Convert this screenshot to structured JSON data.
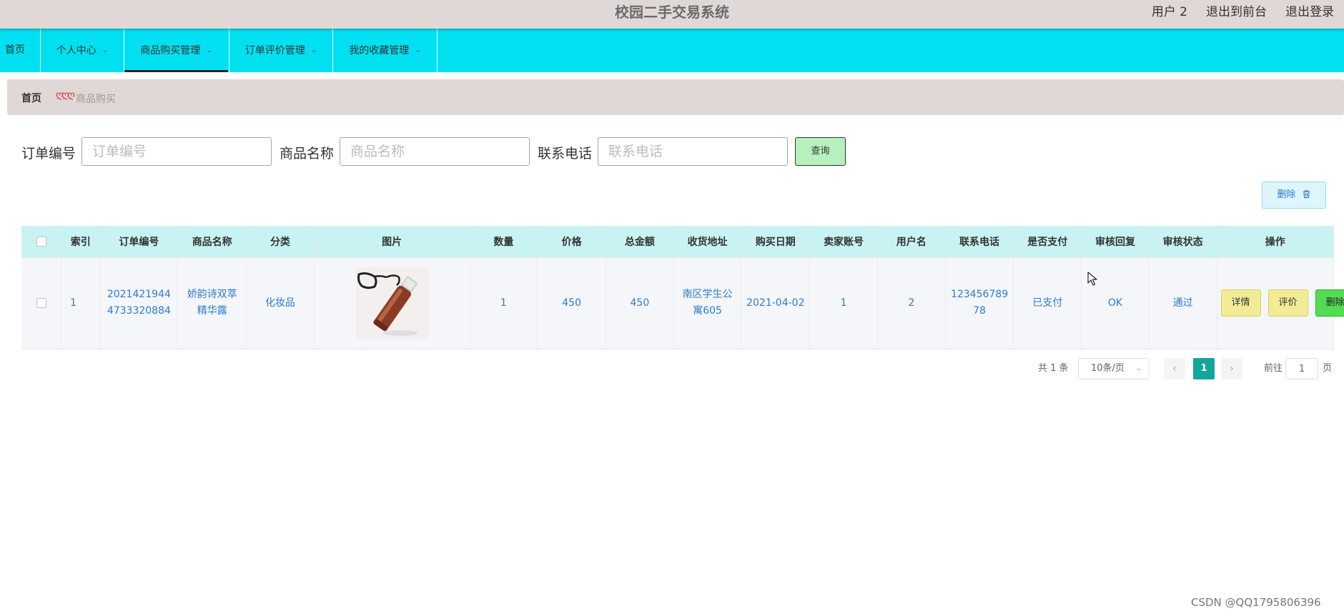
{
  "header": {
    "system_title": "校园二手交易系统",
    "user_label": "用户 2",
    "back_to_front": "退出到前台",
    "logout": "退出登录"
  },
  "nav": {
    "items": [
      {
        "label": "首页",
        "has_dropdown": false
      },
      {
        "label": "个人中心",
        "has_dropdown": true
      },
      {
        "label": "商品购买管理",
        "has_dropdown": true,
        "active": true
      },
      {
        "label": "订单评价管理",
        "has_dropdown": true
      },
      {
        "label": "我的收藏管理",
        "has_dropdown": true
      }
    ]
  },
  "breadcrumb": {
    "home": "首页",
    "separator": "ღღღ",
    "current": "商品购买"
  },
  "search": {
    "order_no_label": "订单编号",
    "order_no_placeholder": "订单编号",
    "product_name_label": "商品名称",
    "product_name_placeholder": "商品名称",
    "phone_label": "联系电话",
    "phone_placeholder": "联系电话",
    "query_button": "查询"
  },
  "toolbar": {
    "delete_label": "删除",
    "delete_icon": "trash-icon"
  },
  "table": {
    "headers": {
      "index": "索引",
      "order_no": "订单编号",
      "product_name": "商品名称",
      "category": "分类",
      "image": "图片",
      "quantity": "数量",
      "price": "价格",
      "total": "总金额",
      "address": "收货地址",
      "date": "购买日期",
      "seller": "卖家账号",
      "username": "用户名",
      "phone": "联系电话",
      "paid": "是否支付",
      "review_reply": "审核回复",
      "review_status": "审核状态",
      "actions": "操作"
    },
    "rows": [
      {
        "index": "1",
        "order_no": "20214219444733320884",
        "product_name": "娇韵诗双萃精华露",
        "category": "化妆品",
        "image": "serum-bottle-photo",
        "quantity": "1",
        "price": "450",
        "total": "450",
        "address": "南区学生公寓605",
        "date": "2021-04-02",
        "seller": "1",
        "username": "2",
        "phone": "12345678978",
        "paid": "已支付",
        "review_reply": "OK",
        "review_status": "通过",
        "actions": {
          "detail": "详情",
          "rate": "评价",
          "delete": "删除"
        }
      }
    ]
  },
  "pagination": {
    "total_text": "共 1 条",
    "page_size": "10条/页",
    "current_page": "1",
    "goto_label": "前往",
    "goto_value": "1",
    "page_unit": "页"
  },
  "watermark": "CSDN @QQ1795806396",
  "colors": {
    "topbar": "#e0d8d6",
    "nav": "#00e0f0",
    "table_header": "#c8f3f2",
    "link_text": "#2b7bd3",
    "page_active": "#13a69b"
  }
}
